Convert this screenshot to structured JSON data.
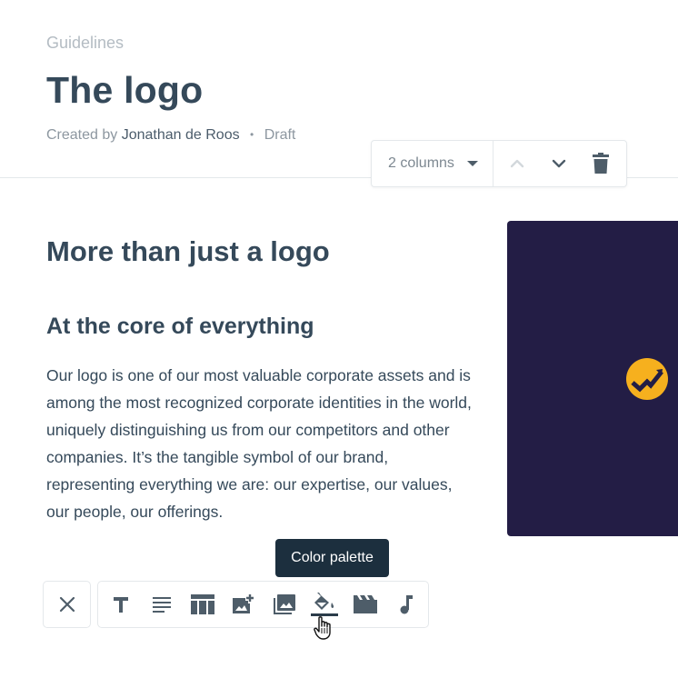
{
  "header": {
    "breadcrumb": "Guidelines",
    "title": "The logo",
    "created_by_label": "Created by",
    "author": "Jonathan de Roos",
    "separator": "•",
    "status": "Draft"
  },
  "block_toolbar": {
    "columns_value": "2 columns",
    "icons": [
      "chevron-up-icon",
      "chevron-down-icon",
      "trash-icon"
    ]
  },
  "content": {
    "section_heading": "More than just a logo",
    "sub_heading": "At the core of everything",
    "body": "Our logo is one of our most valuable corporate assets and is among the most recognized corporate identities in the world, uniquely distinguishing us from our competitors and other companies. It’s the tangible symbol of our brand, representing everything we are: our expertise, our values, our people, our offerings."
  },
  "logo_panel": {
    "background_color": "#231d45",
    "mark_color": "#f6b01e"
  },
  "insert_toolbar": {
    "tooltip": "Color palette",
    "active_tool": "color-palette",
    "tools": [
      "text",
      "paragraph",
      "table",
      "add-image",
      "gallery",
      "color-palette",
      "video",
      "audio"
    ]
  },
  "colors": {
    "text_primary": "#35495a",
    "muted": "#8d97a0",
    "tooltip_bg": "#1c2f3e",
    "border": "#e4e8eb"
  }
}
